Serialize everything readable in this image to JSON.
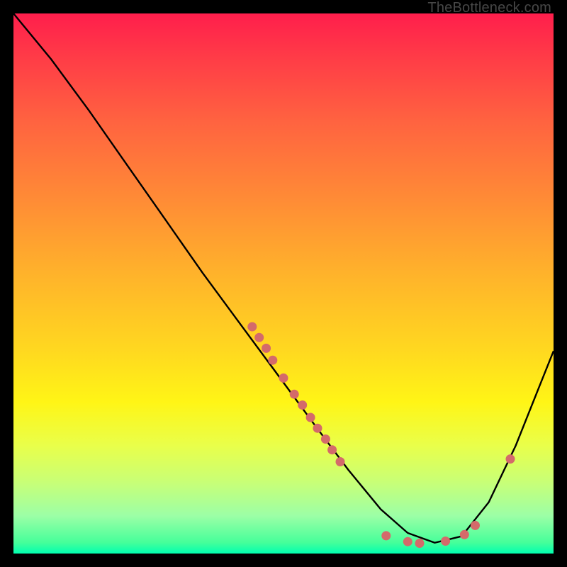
{
  "attribution": "TheBottleneck.com",
  "chart_data": {
    "type": "line",
    "title": "",
    "xlabel": "",
    "ylabel": "",
    "xlim": [
      0,
      1
    ],
    "ylim": [
      0,
      1
    ],
    "curve": [
      {
        "x": 0.0,
        "y": 1.0
      },
      {
        "x": 0.07,
        "y": 0.915
      },
      {
        "x": 0.14,
        "y": 0.82
      },
      {
        "x": 0.21,
        "y": 0.72
      },
      {
        "x": 0.28,
        "y": 0.62
      },
      {
        "x": 0.35,
        "y": 0.52
      },
      {
        "x": 0.42,
        "y": 0.425
      },
      {
        "x": 0.49,
        "y": 0.33
      },
      {
        "x": 0.56,
        "y": 0.235
      },
      {
        "x": 0.62,
        "y": 0.155
      },
      {
        "x": 0.68,
        "y": 0.082
      },
      {
        "x": 0.73,
        "y": 0.038
      },
      {
        "x": 0.78,
        "y": 0.02
      },
      {
        "x": 0.83,
        "y": 0.032
      },
      {
        "x": 0.88,
        "y": 0.095
      },
      {
        "x": 0.93,
        "y": 0.2
      },
      {
        "x": 0.97,
        "y": 0.3
      },
      {
        "x": 1.0,
        "y": 0.375
      }
    ],
    "dots": [
      {
        "x": 0.442,
        "y": 0.42
      },
      {
        "x": 0.455,
        "y": 0.4
      },
      {
        "x": 0.468,
        "y": 0.38
      },
      {
        "x": 0.48,
        "y": 0.358
      },
      {
        "x": 0.5,
        "y": 0.325
      },
      {
        "x": 0.52,
        "y": 0.295
      },
      {
        "x": 0.535,
        "y": 0.275
      },
      {
        "x": 0.55,
        "y": 0.252
      },
      {
        "x": 0.563,
        "y": 0.232
      },
      {
        "x": 0.578,
        "y": 0.212
      },
      {
        "x": 0.59,
        "y": 0.192
      },
      {
        "x": 0.605,
        "y": 0.17
      },
      {
        "x": 0.69,
        "y": 0.033
      },
      {
        "x": 0.73,
        "y": 0.022
      },
      {
        "x": 0.752,
        "y": 0.019
      },
      {
        "x": 0.8,
        "y": 0.023
      },
      {
        "x": 0.835,
        "y": 0.035
      },
      {
        "x": 0.855,
        "y": 0.052
      },
      {
        "x": 0.92,
        "y": 0.175
      }
    ],
    "marker_color": "#d46a6a",
    "line_color": "#000000"
  }
}
